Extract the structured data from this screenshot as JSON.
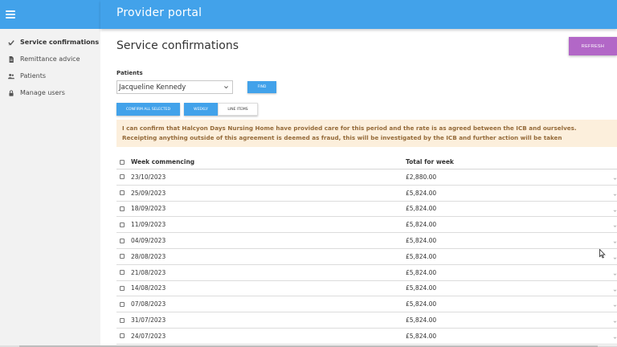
{
  "app": {
    "title": "Provider portal"
  },
  "sidebar": {
    "items": [
      {
        "label": "Service confirmations",
        "icon": "check-icon",
        "active": true
      },
      {
        "label": "Remittance advice",
        "icon": "document-icon",
        "active": false
      },
      {
        "label": "Patients",
        "icon": "people-icon",
        "active": false
      },
      {
        "label": "Manage users",
        "icon": "lock-icon",
        "active": false
      }
    ]
  },
  "page": {
    "title": "Service confirmations",
    "refresh_label": "REFRESH",
    "patients_label": "Patients",
    "patient_selected": "Jacqueline Kennedy",
    "find_label": "FIND",
    "confirm_all_label": "CONFIRM ALL SELECTED",
    "view_toggle": {
      "weekly": "WEEKLY",
      "line_items": "LINE ITEMS",
      "selected": "WEEKLY"
    },
    "warning_text": "I can confirm that Halcyon Days Nursing Home have provided care for this period and the rate is as agreed between the ICB and ourselves. Receipting anything outside of this agreement is deemed as fraud, this will be investigated by the ICB and further action will be taken"
  },
  "table": {
    "headers": {
      "week": "Week commencing",
      "total": "Total for week"
    },
    "rows": [
      {
        "week": "23/10/2023",
        "total": "£2,880.00"
      },
      {
        "week": "25/09/2023",
        "total": "£5,824.00"
      },
      {
        "week": "18/09/2023",
        "total": "£5,824.00"
      },
      {
        "week": "11/09/2023",
        "total": "£5,824.00"
      },
      {
        "week": "04/09/2023",
        "total": "£5,824.00"
      },
      {
        "week": "28/08/2023",
        "total": "£5,824.00"
      },
      {
        "week": "21/08/2023",
        "total": "£5,824.00"
      },
      {
        "week": "14/08/2023",
        "total": "£5,824.00"
      },
      {
        "week": "07/08/2023",
        "total": "£5,824.00"
      },
      {
        "week": "31/07/2023",
        "total": "£5,824.00"
      },
      {
        "week": "24/07/2023",
        "total": "£5,824.00"
      }
    ]
  },
  "colors": {
    "primary": "#42a2ea",
    "refresh": "#b267c7",
    "warning_bg": "#fcefdc",
    "warning_text": "#946a39"
  }
}
